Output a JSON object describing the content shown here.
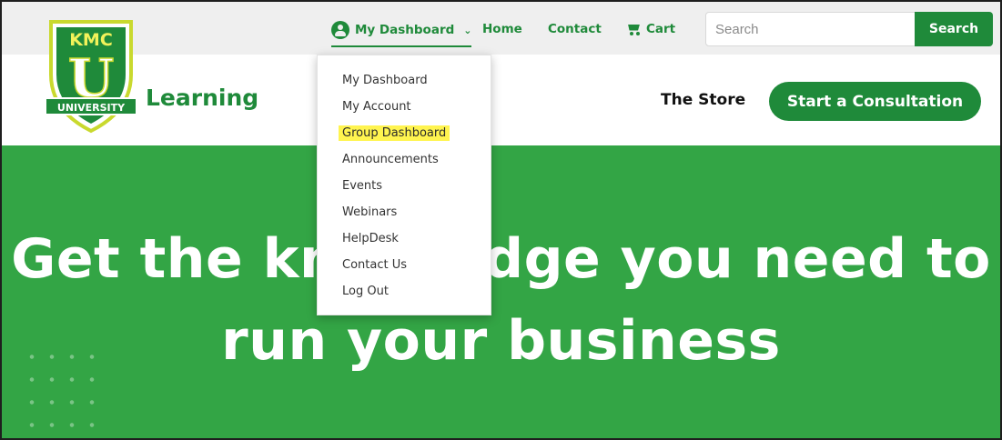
{
  "nav": {
    "dashboard_label": "My Dashboard",
    "home_label": "Home",
    "contact_label": "Contact",
    "cart_label": "Cart",
    "search_placeholder": "Search",
    "search_button": "Search"
  },
  "header": {
    "logo_top": "KMC",
    "logo_letter": "U",
    "logo_ribbon": "UNIVERSITY",
    "brand": "Learning",
    "store_label": "The Store",
    "consult_label": "Start a Consultation"
  },
  "dropdown": {
    "items": [
      {
        "label": "My Dashboard"
      },
      {
        "label": "My Account"
      },
      {
        "label": "Group Dashboard",
        "highlighted": true
      },
      {
        "label": "Announcements"
      },
      {
        "label": "Events"
      },
      {
        "label": "Webinars"
      },
      {
        "label": "HelpDesk"
      },
      {
        "label": "Contact Us"
      },
      {
        "label": "Log Out"
      }
    ]
  },
  "hero": {
    "line1": "Get the knowledge you need to",
    "line2": "run your business"
  },
  "colors": {
    "brand_green": "#1f8a3a",
    "hero_green": "#33a545",
    "highlight": "#fff44f"
  }
}
